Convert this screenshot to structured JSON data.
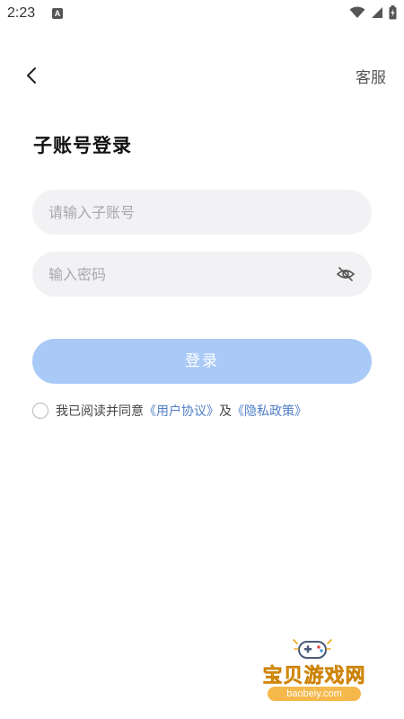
{
  "status_bar": {
    "time": "2:23",
    "notification_icon": "A",
    "icons": [
      "wifi-icon",
      "signal-icon",
      "battery-icon"
    ]
  },
  "nav": {
    "back_icon": "chevron-left-icon",
    "service_label": "客服"
  },
  "page": {
    "title": "子账号登录"
  },
  "form": {
    "account_placeholder": "请输入子账号",
    "account_value": "",
    "password_placeholder": "输入密码",
    "password_value": "",
    "password_toggle_icon": "eye-off-icon",
    "login_label": "登录"
  },
  "agreement": {
    "checked": false,
    "prefix": "我已阅读并同意",
    "user_agreement": "《用户协议》",
    "conjunction": "及",
    "privacy_policy": "《隐私政策》"
  },
  "watermark": {
    "title": "宝贝游戏网",
    "url": "baobeiy.com"
  },
  "colors": {
    "primary_button": "#a9c9f7",
    "link": "#4f7fc7",
    "field_bg": "#f2f2f4",
    "watermark": "#f3a520"
  }
}
